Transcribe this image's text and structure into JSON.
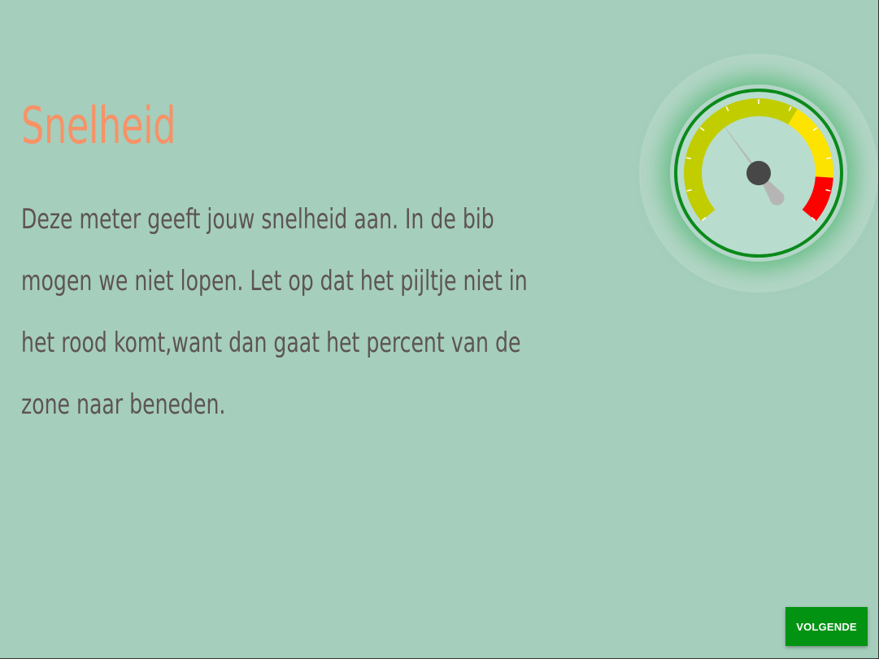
{
  "page": {
    "title": "Snelheid",
    "description": "Deze meter geeft jouw snelheid aan. In de bib mogen we niet lopen. Let op dat het pijltje niet in het rood komt,want dan gaat het percent van de zone naar beneden."
  },
  "gauge": {
    "icon": "speedometer-icon",
    "needle_level": 0.36,
    "zones": [
      {
        "name": "green-yellow",
        "color": "#c2cd00",
        "from": 0.0,
        "to": 0.62
      },
      {
        "name": "yellow",
        "color": "#fde300",
        "from": 0.62,
        "to": 0.86
      },
      {
        "name": "red",
        "color": "#ff0000",
        "from": 0.86,
        "to": 1.0
      }
    ],
    "tick_count": 11
  },
  "actions": {
    "next_label": "VOLGENDE"
  },
  "colors": {
    "background": "#a5cebd",
    "title": "#f79266",
    "text": "#5d5454",
    "button": "#039313",
    "gauge_ring": "#0a8a1a"
  }
}
